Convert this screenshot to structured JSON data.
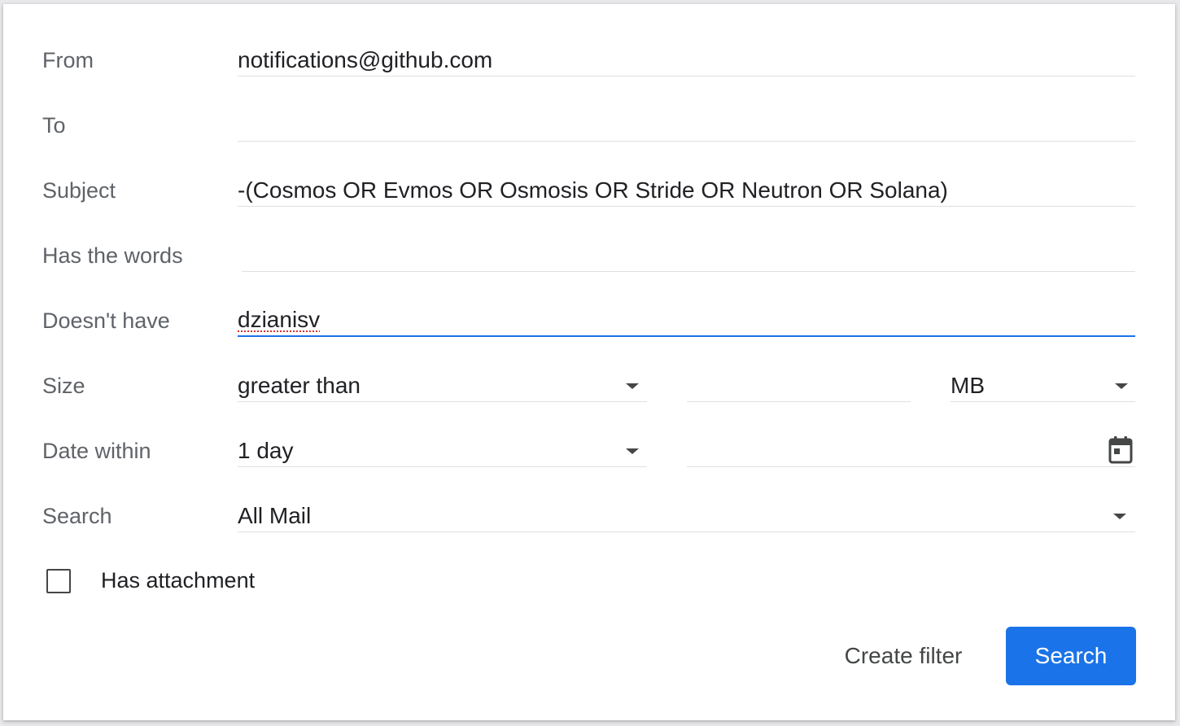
{
  "form": {
    "from": {
      "label": "From",
      "value": "notifications@github.com"
    },
    "to": {
      "label": "To",
      "value": ""
    },
    "subject": {
      "label": "Subject",
      "value": "-(Cosmos OR Evmos OR Osmosis OR Stride OR Neutron OR Solana)"
    },
    "has_words": {
      "label": "Has the words",
      "value": ""
    },
    "doesnt_have": {
      "label": "Doesn't have",
      "value": "dzianisv"
    },
    "size": {
      "label": "Size",
      "operator": "greater than",
      "amount": "",
      "unit": "MB"
    },
    "date_within": {
      "label": "Date within",
      "range": "1 day",
      "date": ""
    },
    "search": {
      "label": "Search",
      "scope": "All Mail"
    },
    "has_attachment": {
      "label": "Has attachment",
      "checked": false
    }
  },
  "actions": {
    "create_filter": "Create filter",
    "search": "Search"
  },
  "colors": {
    "accent": "#1a73e8",
    "label": "#5f6368",
    "text": "#202124"
  },
  "icons": [
    "caret-down-icon",
    "calendar-icon"
  ]
}
